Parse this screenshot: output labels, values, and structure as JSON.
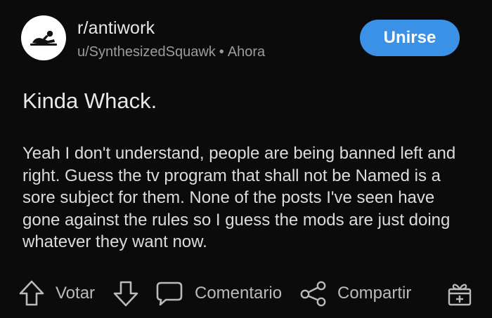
{
  "post": {
    "subreddit": "r/antiwork",
    "author": "u/SynthesizedSquawk",
    "separator": "•",
    "time": "Ahora",
    "join_label": "Unirse",
    "title": "Kinda Whack.",
    "body": "Yeah I don't understand, people are being banned left and right. Guess the tv program that shall not be Named is a sore subject for them. None of the posts I've seen have gone against the rules so I guess the mods are just doing whatever they want now."
  },
  "actions": {
    "vote_label": "Votar",
    "comment_label": "Comentario",
    "share_label": "Compartir"
  },
  "icons": {
    "avatar": "reclining-figure-icon",
    "upvote": "arrow-up-icon",
    "downvote": "arrow-down-icon",
    "comment": "speech-bubble-icon",
    "share": "share-nodes-icon",
    "award": "gift-icon"
  },
  "colors": {
    "background": "#0b0b0c",
    "join_button": "#3b91e6",
    "text_primary": "#e8e8e8",
    "text_muted": "#9a9c9f"
  }
}
